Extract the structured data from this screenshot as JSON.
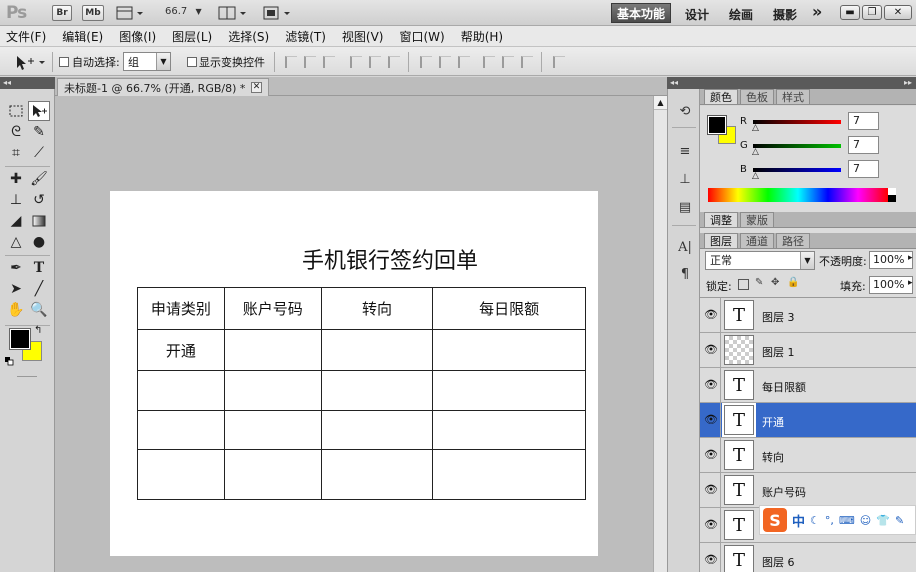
{
  "appbar": {
    "logo": "Ps",
    "bridge": "Br",
    "minibridge": "Mb",
    "zoom": "66.7",
    "workspaces": [
      "基本功能",
      "设计",
      "绘画",
      "摄影"
    ],
    "more": "»"
  },
  "menu": [
    "文件(F)",
    "编辑(E)",
    "图像(I)",
    "图层(L)",
    "选择(S)",
    "滤镜(T)",
    "视图(V)",
    "窗口(W)",
    "帮助(H)"
  ],
  "options": {
    "auto_select_label": "自动选择:",
    "auto_select_value": "组",
    "transform_label": "显示变换控件"
  },
  "document": {
    "tab_title": "未标题-1 @ 66.7% (开通, RGB/8) *",
    "title": "手机银行签约回单",
    "table": {
      "headers": [
        "申请类别",
        "账户号码",
        "转向",
        "每日限额"
      ],
      "rows": [
        [
          "开通",
          "",
          "",
          ""
        ],
        [
          "",
          "",
          "",
          ""
        ],
        [
          "",
          "",
          "",
          ""
        ],
        [
          "",
          "",
          "",
          ""
        ]
      ]
    }
  },
  "color_panel": {
    "tabs": [
      "颜色",
      "色板",
      "样式"
    ],
    "channels": [
      {
        "label": "R",
        "value": "7",
        "color": "#ff0000"
      },
      {
        "label": "G",
        "value": "7",
        "color": "#00c000"
      },
      {
        "label": "B",
        "value": "7",
        "color": "#0000ff"
      }
    ],
    "foreground": "#000000",
    "background": "#ffff00"
  },
  "adjust_panel": {
    "tabs": [
      "调整",
      "蒙版"
    ]
  },
  "layers_panel": {
    "tabs": [
      "图层",
      "通道",
      "路径"
    ],
    "blend_mode": "正常",
    "opacity_label": "不透明度:",
    "opacity_value": "100%",
    "lock_label": "锁定:",
    "fill_label": "填充:",
    "fill_value": "100%",
    "layers": [
      {
        "name": "图层 3",
        "type": "text",
        "selected": false
      },
      {
        "name": "图层 1",
        "type": "raster",
        "selected": false
      },
      {
        "name": "每日限额",
        "type": "text",
        "selected": false
      },
      {
        "name": "开通",
        "type": "text",
        "selected": true
      },
      {
        "name": "转向",
        "type": "text",
        "selected": false
      },
      {
        "name": "账户号码",
        "type": "text",
        "selected": false
      },
      {
        "name": "",
        "type": "text",
        "selected": false
      },
      {
        "name": "图层 6",
        "type": "text",
        "selected": false
      }
    ]
  },
  "ime": {
    "logo": "S",
    "mode": "中"
  }
}
